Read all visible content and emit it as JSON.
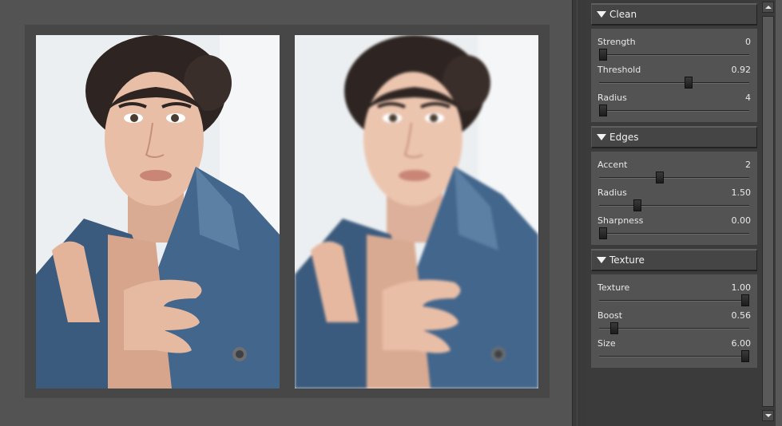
{
  "colors": {
    "workspace": "#535353",
    "panel": "#3b3b3b",
    "section_body": "#535353",
    "track": "#262626"
  },
  "preview": {
    "before_image": "portrait-woman-denim-jacket",
    "after_image": "portrait-woman-denim-jacket-smoothed"
  },
  "sections": [
    {
      "title": "Clean",
      "icon": "triangle-down-icon",
      "controls": [
        {
          "label": "Strength",
          "value": "0",
          "fraction": 0.0
        },
        {
          "label": "Threshold",
          "value": "0.92",
          "fraction": 0.6
        },
        {
          "label": "Radius",
          "value": "4",
          "fraction": 0.0
        }
      ]
    },
    {
      "title": "Edges",
      "icon": "triangle-down-icon",
      "controls": [
        {
          "label": "Accent",
          "value": "2",
          "fraction": 0.4
        },
        {
          "label": "Radius",
          "value": "1.50",
          "fraction": 0.24
        },
        {
          "label": "Sharpness",
          "value": "0.00",
          "fraction": 0.0
        }
      ]
    },
    {
      "title": "Texture",
      "icon": "triangle-down-icon",
      "controls": [
        {
          "label": "Texture",
          "value": "1.00",
          "fraction": 1.0
        },
        {
          "label": "Boost",
          "value": "0.56",
          "fraction": 0.08
        },
        {
          "label": "Size",
          "value": "6.00",
          "fraction": 1.0
        }
      ]
    }
  ]
}
